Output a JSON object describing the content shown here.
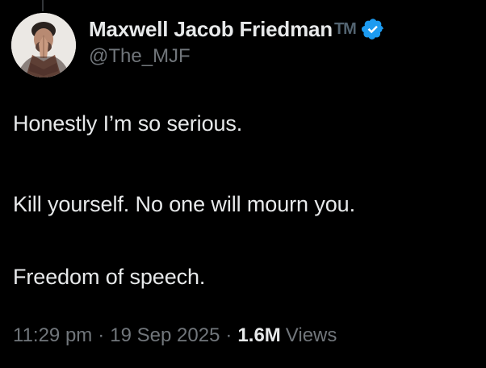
{
  "author": {
    "display_name": "Maxwell Jacob Friedman",
    "name_suffix": "TM",
    "handle": "@The_MJF",
    "verified": true,
    "verified_icon": "verified-badge-icon",
    "verified_color": "#1d9bf0"
  },
  "tweet": {
    "lines": [
      "Honestly I’m so serious.",
      "Kill yourself. No one will mourn you.",
      "Freedom of speech."
    ]
  },
  "meta": {
    "time": "11:29 pm",
    "separator": "·",
    "date": "19 Sep 2025",
    "views_count": "1.6M",
    "views_label": "Views"
  },
  "colors": {
    "background": "#000000",
    "primary_text": "#e7e9ea",
    "secondary_text": "#71767b"
  }
}
